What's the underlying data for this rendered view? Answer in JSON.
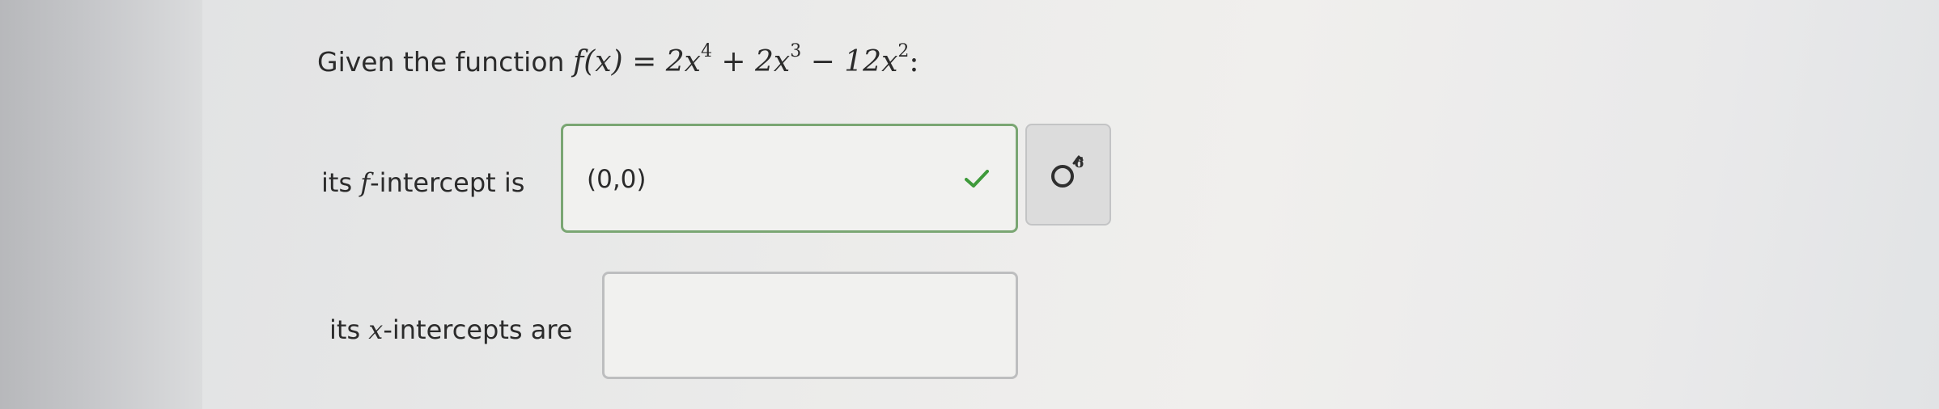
{
  "question": {
    "intro": "Given the function",
    "function_lhs": "f(x) = ",
    "term1": "2x",
    "exp1": "4",
    "term2": " + 2x",
    "exp2": "3",
    "term3": " − 12x",
    "exp3": "2",
    "suffix": ":"
  },
  "f_intercept": {
    "label_prefix": "its ",
    "label_var": "f",
    "label_suffix": "-intercept is",
    "value": "(0,0)",
    "status": "correct",
    "status_color": "#3e9a3a"
  },
  "x_intercepts": {
    "label_prefix": "its ",
    "label_var": "x",
    "label_suffix": "-intercepts are",
    "value": ""
  },
  "tool_button": {
    "icon": "symbol-palette-icon"
  }
}
